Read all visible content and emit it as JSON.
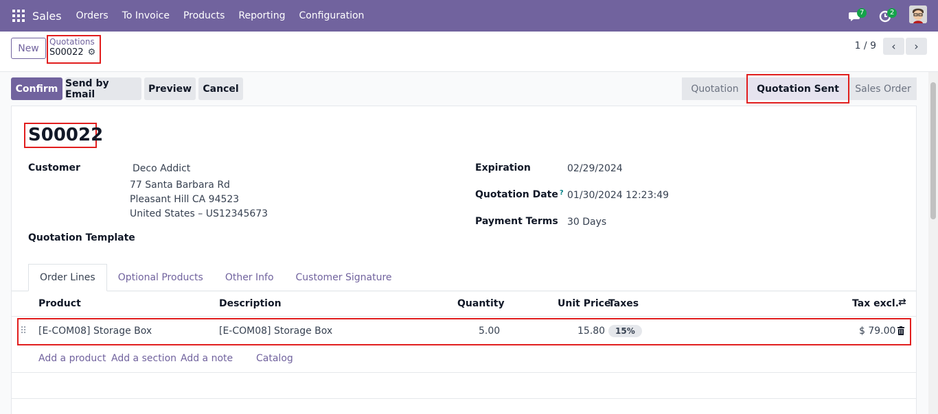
{
  "navbar": {
    "brand": "Sales",
    "menu": [
      "Orders",
      "To Invoice",
      "Products",
      "Reporting",
      "Configuration"
    ],
    "messages_count": "7",
    "activities_count": "2"
  },
  "control": {
    "new_label": "New",
    "breadcrumb_parent": "Quotations",
    "breadcrumb_current": "S00022",
    "pager": "1 / 9"
  },
  "actions": {
    "confirm": "Confirm",
    "send_email": "Send by Email",
    "preview": "Preview",
    "cancel": "Cancel"
  },
  "stages": [
    "Quotation",
    "Quotation Sent",
    "Sales Order"
  ],
  "active_stage": "Quotation Sent",
  "form": {
    "order_name": "S00022",
    "customer_label": "Customer",
    "customer_name": "Deco Addict",
    "customer_address_1": "77 Santa Barbara Rd",
    "customer_address_2": "Pleasant Hill CA 94523",
    "customer_address_3": "United States – US12345673",
    "template_label": "Quotation Template",
    "expiration_label": "Expiration",
    "expiration_value": "02/29/2024",
    "quotation_date_label": "Quotation Date",
    "quotation_date_help": "?",
    "quotation_date_value": "01/30/2024 12:23:49",
    "payment_terms_label": "Payment Terms",
    "payment_terms_value": "30 Days"
  },
  "tabs": [
    "Order Lines",
    "Optional Products",
    "Other Info",
    "Customer Signature"
  ],
  "table": {
    "headers": {
      "product": "Product",
      "description": "Description",
      "quantity": "Quantity",
      "unit_price": "Unit Price",
      "taxes": "Taxes",
      "tax_excl": "Tax excl."
    },
    "rows": [
      {
        "product": "[E-COM08] Storage Box",
        "description": "[E-COM08] Storage Box",
        "quantity": "5.00",
        "unit_price": "15.80",
        "tax": "15%",
        "subtotal": "$ 79.00"
      }
    ],
    "add_links": [
      "Add a product",
      "Add a section",
      "Add a note",
      "Catalog"
    ]
  },
  "colors": {
    "brand": "#71639e",
    "highlight": "#e11d1d"
  }
}
